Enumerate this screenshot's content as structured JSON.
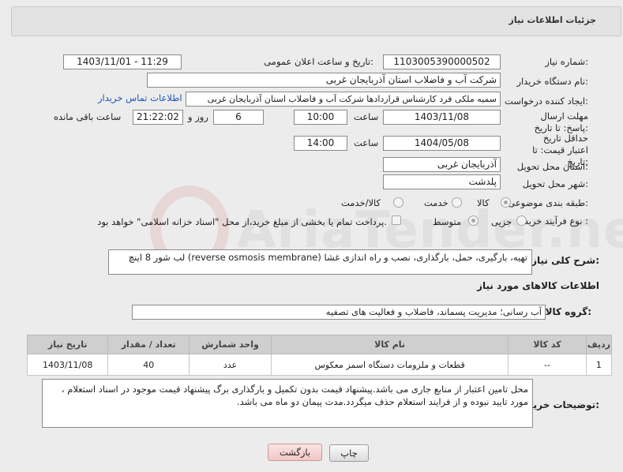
{
  "page": {
    "title": "جزئیات اطلاعات نیاز",
    "watermark": "AriaTender.neT"
  },
  "form": {
    "need_number_label": "شماره نیاز:",
    "need_number": "1103005390000502",
    "announce_label": "تاریخ و ساعت اعلان عمومی:",
    "announce_value": "1403/11/01 - 11:29",
    "buyer_org_label": "نام دستگاه خریدار:",
    "buyer_org": "شرکت آب و فاضلاب استان آذربایجان غربی",
    "creator_label": "ایجاد کننده درخواست:",
    "creator": "سمیه ملکی  فرد کارشناس قراردادها شرکت آب و فاضلاب استان آذربایجان غربی",
    "contact_link": "اطلاعات تماس خریدار",
    "reply_deadline_label": "مهلت ارسال پاسخ: تا تاریخ:",
    "reply_date": "1403/11/08",
    "time_label": "ساعت",
    "reply_time": "10:00",
    "days_value": "6",
    "days_label": "روز و",
    "remaining_time": "21:22:02",
    "remaining_label": "ساعت باقی مانده",
    "price_deadline_label": "حداقل تاریخ اعتبار قیمت: تا تاریخ:",
    "price_date": "1404/05/08",
    "price_time_label": "ساعت",
    "price_time": "14:00",
    "province_label": "استان محل تحویل:",
    "province": "آذربایجان غربی",
    "city_label": "شهر محل تحویل:",
    "city": "پلدشت",
    "category_label": "طبقه بندی موضوعی:",
    "category_options": [
      "کالا",
      "خدمت",
      "کالا/خدمت"
    ],
    "category_selected": "کالا",
    "process_label": "نوع فرآیند خرید :",
    "process_options": [
      "جزیی",
      "متوسط"
    ],
    "process_selected": "جزیی",
    "payment_text": "پرداخت تمام یا بخشی از مبلغ خرید،از محل \"اسناد خزانه اسلامی\" خواهد بود."
  },
  "description": {
    "label": "شرح کلی نیاز:",
    "text": "تهیه، بارگیری، حمل، بارگذاری، نصب و راه اندازی غشا (reverse osmosis membrane) لب شور 8 اینچ"
  },
  "goods": {
    "section_title": "اطلاعات کالاهای مورد نیاز",
    "group_label": "گروه کالا:",
    "group_value": "آب رسانی؛ مدیریت پسماند، فاضلاب و فعالیت های تصفیه",
    "columns": [
      "ردیف",
      "کد کالا",
      "نام کالا",
      "واحد شمارش",
      "تعداد / مقدار",
      "تاریخ نیاز"
    ],
    "rows": [
      {
        "row": "1",
        "code": "--",
        "name": "قطعات و ملزومات دستگاه اسمز معکوس",
        "unit": "عدد",
        "qty": "40",
        "date": "1403/11/08"
      }
    ]
  },
  "notes": {
    "label": "توضیحات خریدار:",
    "text": "محل تامین اعتبار از منابع جاری می باشد.پیشنهاد قیمت بدون تکمیل و بارگذاری برگ پیشنهاد قیمت موجود در اسناد استعلام ، مورد تایید نبوده و از فرایند استعلام حذف میگردد.مدت پیمان دو ماه می باشد."
  },
  "buttons": {
    "print": "چاپ",
    "back": "بازگشت"
  }
}
